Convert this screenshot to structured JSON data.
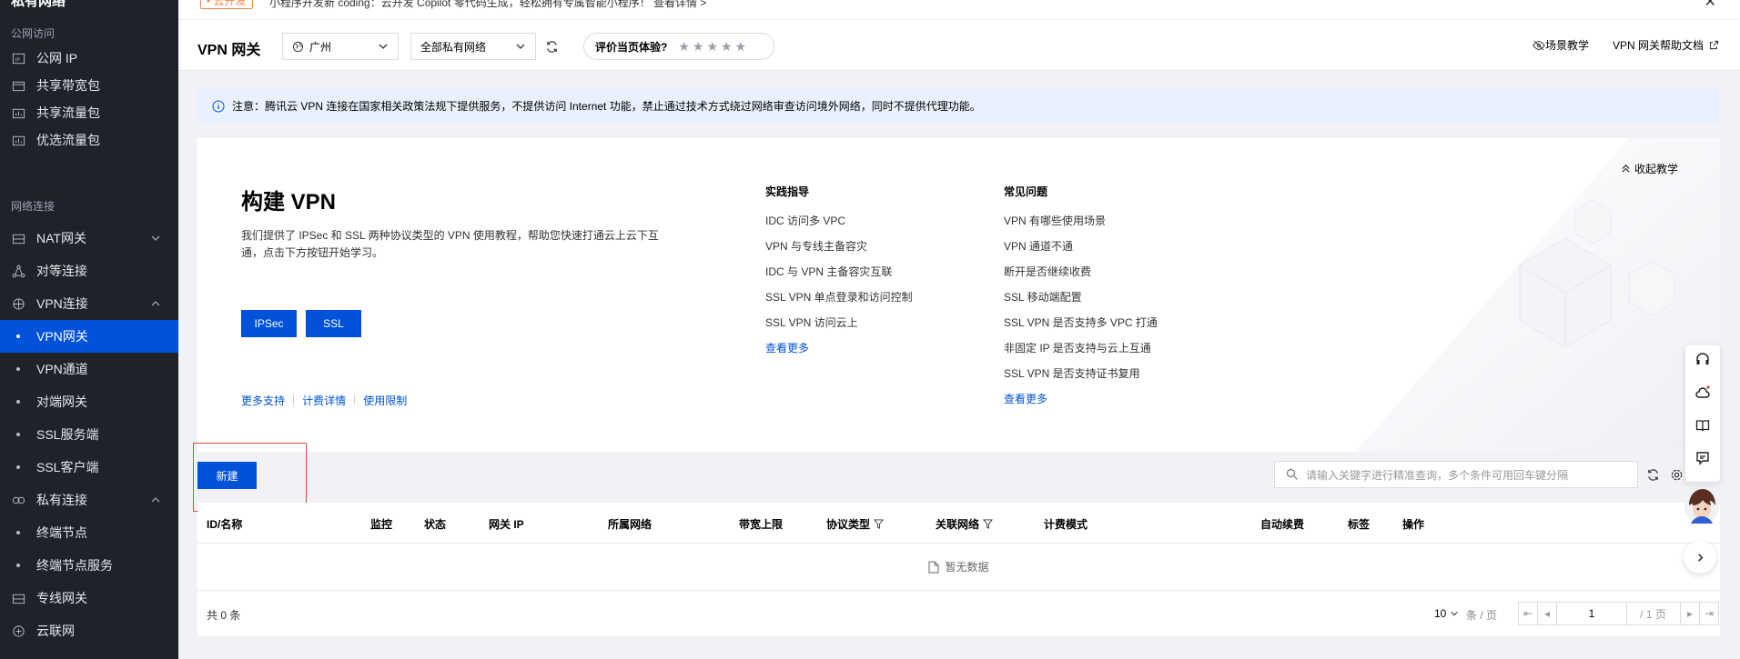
{
  "sidebar": {
    "title": "私有网络",
    "groups": [
      {
        "label": "公网访问"
      },
      {
        "label": "网络连接"
      }
    ],
    "items": [
      {
        "label": "公网 IP",
        "icon": "ip-icon"
      },
      {
        "label": "共享带宽包",
        "icon": "bandwidth-icon"
      },
      {
        "label": "共享流量包",
        "icon": "traffic-package-icon"
      },
      {
        "label": "优选流量包",
        "icon": "preferred-traffic-icon"
      },
      {
        "label": "NAT网关",
        "icon": "nat-gateway-icon"
      },
      {
        "label": "对等连接",
        "icon": "peering-icon"
      },
      {
        "label": "VPN连接",
        "icon": "vpn-icon"
      },
      {
        "label": "VPN网关"
      },
      {
        "label": "VPN通道"
      },
      {
        "label": "对端网关"
      },
      {
        "label": "SSL服务端"
      },
      {
        "label": "SSL客户端"
      },
      {
        "label": "私有连接",
        "icon": "private-link-icon"
      },
      {
        "label": "终端节点"
      },
      {
        "label": "终端节点服务"
      },
      {
        "label": "专线网关",
        "icon": "dc-gateway-icon"
      },
      {
        "label": "云联网",
        "icon": "ccn-icon"
      }
    ]
  },
  "announcement": {
    "tag": "• 云开发",
    "text": "小程序开发新 coding：云开发 Copilot 零代码生成，轻松拥有专属智能小程序！  查看详情 >"
  },
  "header": {
    "title": "VPN 网关",
    "region": "广州",
    "network": "全部私有网络",
    "rating_label": "评价当页体验?",
    "stars": "★★★★★",
    "scene_tutorial": "场景教学",
    "help_doc": "VPN 网关帮助文档"
  },
  "notice": {
    "text": "注意：腾讯云 VPN 连接在国家相关政策法规下提供服务，不提供访问 Internet 功能，禁止通过技术方式绕过网络审查访问境外网络，同时不提供代理功能。"
  },
  "tutorial": {
    "title": "构建 VPN",
    "desc": "我们提供了 IPSec 和 SSL 两种协议类型的 VPN 使用教程，帮助您快速打通云上云下互通，点击下方按钮开始学习。",
    "btn_ipsec": "IPSec",
    "btn_ssl": "SSL",
    "links": [
      "更多支持",
      "计费详情",
      "使用限制"
    ],
    "collapse": "收起教学",
    "practice": {
      "heading": "实践指导",
      "items": [
        "IDC 访问多 VPC",
        "VPN 与专线主备容灾",
        "IDC 与 VPN 主备容灾互联",
        "SSL VPN 单点登录和访问控制",
        "SSL VPN 访问云上"
      ],
      "more": "查看更多"
    },
    "faq": {
      "heading": "常见问题",
      "items": [
        "VPN 有哪些使用场景",
        "VPN 通道不通",
        "断开是否继续收费",
        "SSL 移动端配置",
        "SSL VPN 是否支持多 VPC 打通",
        "非固定 IP 是否支持与云上互通",
        "SSL VPN 是否支持证书复用"
      ],
      "more": "查看更多"
    }
  },
  "toolbar": {
    "new_label": "新建",
    "search_placeholder": "请输入关键字进行精准查询，多个条件可用回车键分隔"
  },
  "table": {
    "columns": [
      "ID/名称",
      "监控",
      "状态",
      "网关 IP",
      "所属网络",
      "带宽上限",
      "协议类型",
      "关联网络",
      "计费模式",
      "自动续费",
      "标签",
      "操作"
    ],
    "empty": "暂无数据",
    "total": "共 0 条",
    "page_size": "10",
    "per_page": "条 / 页",
    "page": "1",
    "page_total": "/ 1 页"
  }
}
